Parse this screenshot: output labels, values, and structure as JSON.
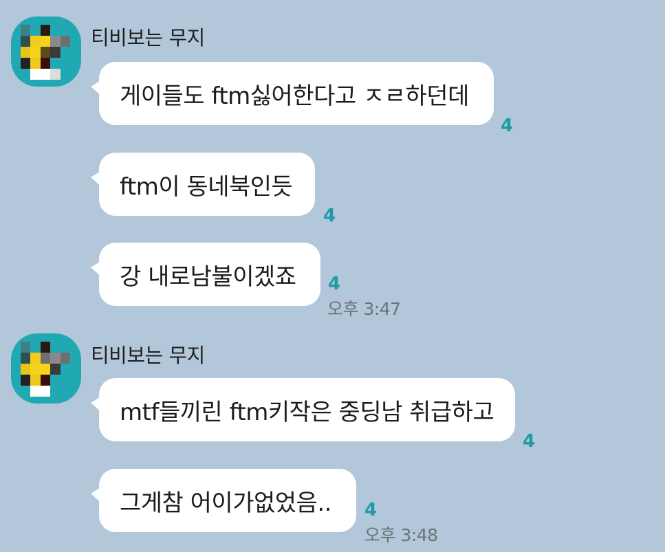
{
  "colors": {
    "background": "#b2c7d9",
    "bubble": "#ffffff",
    "avatar": "#20a9b3",
    "unread": "#1d9ba4",
    "time": "#6a7278"
  },
  "groups": [
    {
      "sender": "티비보는 무지",
      "avatar_icon": "mosaic-avatar-icon",
      "messages": [
        {
          "text": "게이들도 ftm싫어한다고 ㅈㄹ하던데",
          "unread": "4"
        },
        {
          "text": "ftm이 동네북인듯",
          "unread": "4"
        },
        {
          "text": "강 내로남불이겠죠",
          "unread": "4",
          "time": "오후 3:47"
        }
      ]
    },
    {
      "sender": "티비보는 무지",
      "avatar_icon": "mosaic-avatar-icon",
      "messages": [
        {
          "text": "mtf들끼린 ftm키작은 중딩남 취급하고",
          "unread": "4"
        },
        {
          "text": "그게참 어이가없었음..",
          "unread": "4",
          "time": "오후 3:48"
        }
      ]
    }
  ]
}
